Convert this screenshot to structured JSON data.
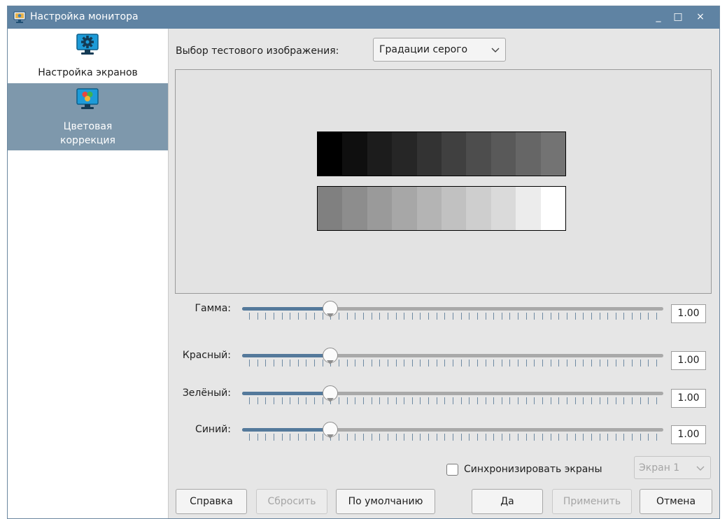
{
  "window": {
    "title": "Настройка монитора",
    "minimize": "_",
    "maximize": "□",
    "close": "×"
  },
  "sidebar": {
    "items": [
      {
        "label": "Настройка экранов",
        "icon": "monitor-settings-icon",
        "selected": false
      },
      {
        "label": "Цветовая\nкоррекция",
        "icon": "monitor-color-icon",
        "selected": true
      }
    ]
  },
  "picker": {
    "label": "Выбор тестового изображения:",
    "value": "Градации серого"
  },
  "preview": {
    "top_strip": [
      "#000000",
      "#0f0f0f",
      "#1c1c1c",
      "#262626",
      "#333333",
      "#404040",
      "#4d4d4d",
      "#595959",
      "#666666",
      "#737373"
    ],
    "bottom_strip": [
      "#808080",
      "#8d8d8d",
      "#9a9a9a",
      "#a7a7a7",
      "#b4b4b4",
      "#c1c1c1",
      "#cecece",
      "#dadada",
      "#ececec",
      "#ffffff"
    ]
  },
  "sliders": {
    "gamma": {
      "label": "Гамма:",
      "value": "1.00",
      "fraction": 0.2
    },
    "red": {
      "label": "Красный:",
      "value": "1.00",
      "fraction": 0.2
    },
    "green": {
      "label": "Зелёный:",
      "value": "1.00",
      "fraction": 0.2
    },
    "blue": {
      "label": "Синий:",
      "value": "1.00",
      "fraction": 0.2
    },
    "tick_count": 51
  },
  "sync": {
    "label": "Синхронизировать экраны",
    "checked": false
  },
  "screen_select": {
    "value": "Экран 1"
  },
  "buttons": {
    "help": "Справка",
    "reset": "Сбросить",
    "defaults": "По умолчанию",
    "ok": "Да",
    "apply": "Применить",
    "cancel": "Отмена"
  },
  "colors": {
    "titlebar": "#5f83a3",
    "selected_item": "#7e98ac",
    "slider_fill": "#54799b",
    "slider_track": "#a9a9a9",
    "window_bg": "#e6e6e6"
  }
}
